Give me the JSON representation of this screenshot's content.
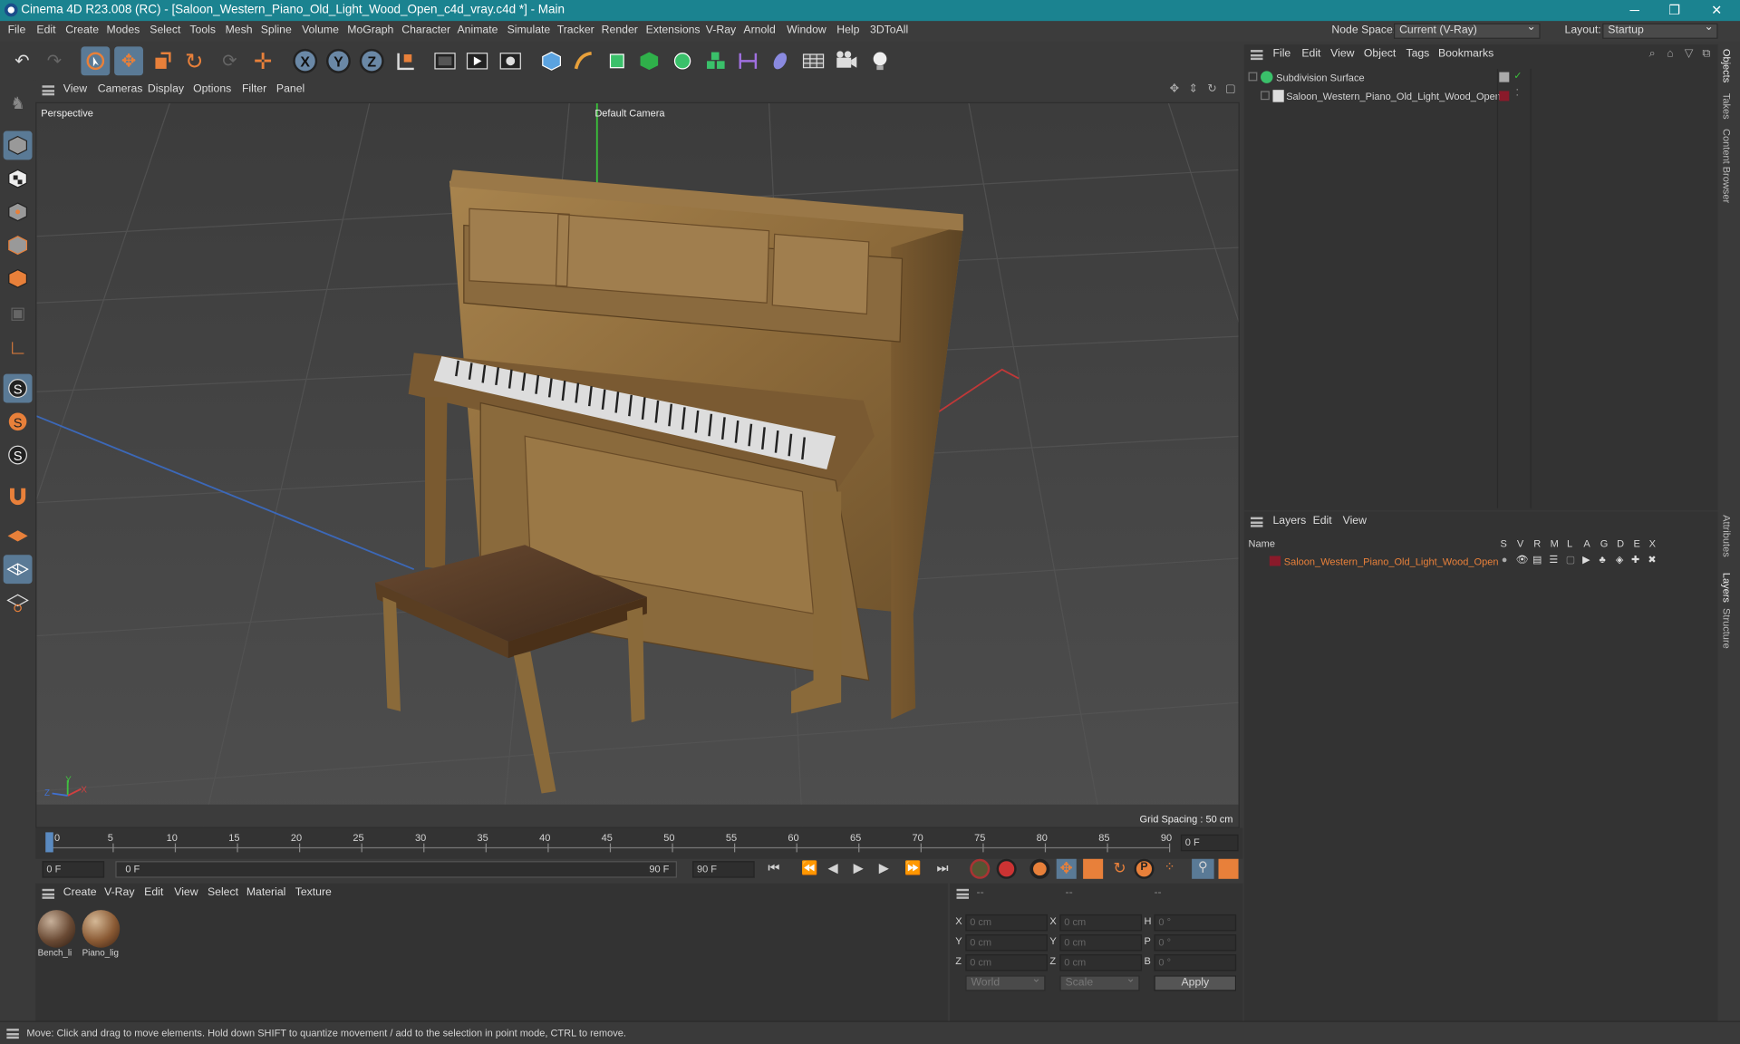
{
  "window": {
    "title": "Cinema 4D R23.008 (RC) - [Saloon_Western_Piano_Old_Light_Wood_Open_c4d_vray.c4d *] - Main",
    "minimize": "─",
    "maximize": "❐",
    "close": "✕"
  },
  "menubar": {
    "items": [
      "File",
      "Edit",
      "Create",
      "Modes",
      "Select",
      "Tools",
      "Mesh",
      "Spline",
      "Volume",
      "MoGraph",
      "Character",
      "Animate",
      "Simulate",
      "Tracker",
      "Render",
      "Extensions",
      "V-Ray",
      "Arnold",
      "Window",
      "Help",
      "3DToAll"
    ],
    "node_space_label": "Node Space:",
    "node_space_value": "Current (V-Ray)",
    "layout_label": "Layout:",
    "layout_value": "Startup"
  },
  "toolbar": {
    "axis_x": "X",
    "axis_y": "Y",
    "axis_z": "Z"
  },
  "viewport": {
    "menu": [
      "View",
      "Cameras",
      "Display",
      "Options",
      "Filter",
      "Panel"
    ],
    "view_name": "Perspective",
    "camera": "Default Camera",
    "grid_spacing": "Grid Spacing : 50 cm",
    "axis_x": "X",
    "axis_y": "Y",
    "axis_z": "Z"
  },
  "timeline": {
    "ticks": [
      "0",
      "5",
      "10",
      "15",
      "20",
      "25",
      "30",
      "35",
      "40",
      "45",
      "50",
      "55",
      "60",
      "65",
      "70",
      "75",
      "80",
      "85",
      "90"
    ],
    "current_frame": "0 F"
  },
  "transport": {
    "start": "0 F",
    "range_start": "0 F",
    "range_end": "90 F",
    "end": "90 F"
  },
  "materials": {
    "menu": [
      "Create",
      "V-Ray",
      "Edit",
      "View",
      "Select",
      "Material",
      "Texture"
    ],
    "items": [
      {
        "name": "Bench_li"
      },
      {
        "name": "Piano_lig"
      }
    ]
  },
  "attributes": {
    "headers": [
      "--",
      "--",
      "--"
    ],
    "rows": [
      {
        "a": "X",
        "av": "0 cm",
        "b": "X",
        "bv": "0 cm",
        "c": "H",
        "cv": "0 °"
      },
      {
        "a": "Y",
        "av": "0 cm",
        "b": "Y",
        "bv": "0 cm",
        "c": "P",
        "cv": "0 °"
      },
      {
        "a": "Z",
        "av": "0 cm",
        "b": "Z",
        "bv": "0 cm",
        "c": "B",
        "cv": "0 °"
      }
    ],
    "coord_mode": "World",
    "size_mode": "Scale",
    "apply": "Apply"
  },
  "objects": {
    "menu": [
      "File",
      "Edit",
      "View",
      "Object",
      "Tags",
      "Bookmarks"
    ],
    "items": [
      {
        "name": "Subdivision Surface"
      },
      {
        "name": "Saloon_Western_Piano_Old_Light_Wood_Open"
      }
    ]
  },
  "layers": {
    "menu": [
      "Layers",
      "Edit",
      "View"
    ],
    "columns": [
      "Name",
      "S",
      "V",
      "R",
      "M",
      "L",
      "A",
      "G",
      "D",
      "E",
      "X"
    ],
    "items": [
      {
        "name": "Saloon_Western_Piano_Old_Light_Wood_Open"
      }
    ],
    "accent": "#e8803a"
  },
  "right_tabs": [
    "Objects",
    "Takes",
    "Content Browser",
    "Attributes",
    "Layers",
    "Structure"
  ],
  "status": {
    "text": "Move: Click and drag to move elements. Hold down SHIFT to quantize movement / add to the selection in point mode, CTRL to remove."
  },
  "colors": {
    "titlebar": "#1b8390",
    "accent_orange": "#e8803a",
    "axis_x": "#d04040",
    "axis_y": "#40c040",
    "axis_z": "#4070d0"
  }
}
